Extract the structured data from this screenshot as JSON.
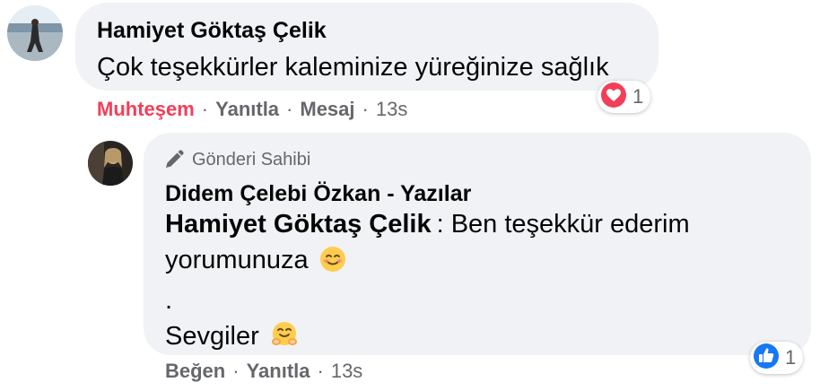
{
  "comment1": {
    "author": "Hamiyet Göktaş Çelik",
    "text": "Çok teşekkürler kaleminize yüreğinize sağlık",
    "reaction_count": "1",
    "actions": {
      "reaction_label": "Muhteşem",
      "reply": "Yanıtla",
      "message": "Mesaj",
      "time": "13s"
    }
  },
  "reply1": {
    "author_badge": "Gönderi Sahibi",
    "author": "Didem Çelebi Özkan - Yazılar",
    "mention": "Hamiyet Göktaş Çelik",
    "line1": ": Ben teşekkür ederim",
    "line2": "yorumunuza",
    "line3": ".",
    "line4": "Sevgiler",
    "reaction_count": "1",
    "actions": {
      "like": "Beğen",
      "reply": "Yanıtla",
      "time": "13s"
    }
  },
  "colors": {
    "bubble": "#f0f2f5",
    "love": "#f33e58",
    "like": "#1877f2",
    "secondary_text": "#65676b"
  },
  "icons": {
    "love_reaction": "heart-icon",
    "like_reaction": "thumbs-up-icon",
    "author_badge": "pen-icon"
  }
}
